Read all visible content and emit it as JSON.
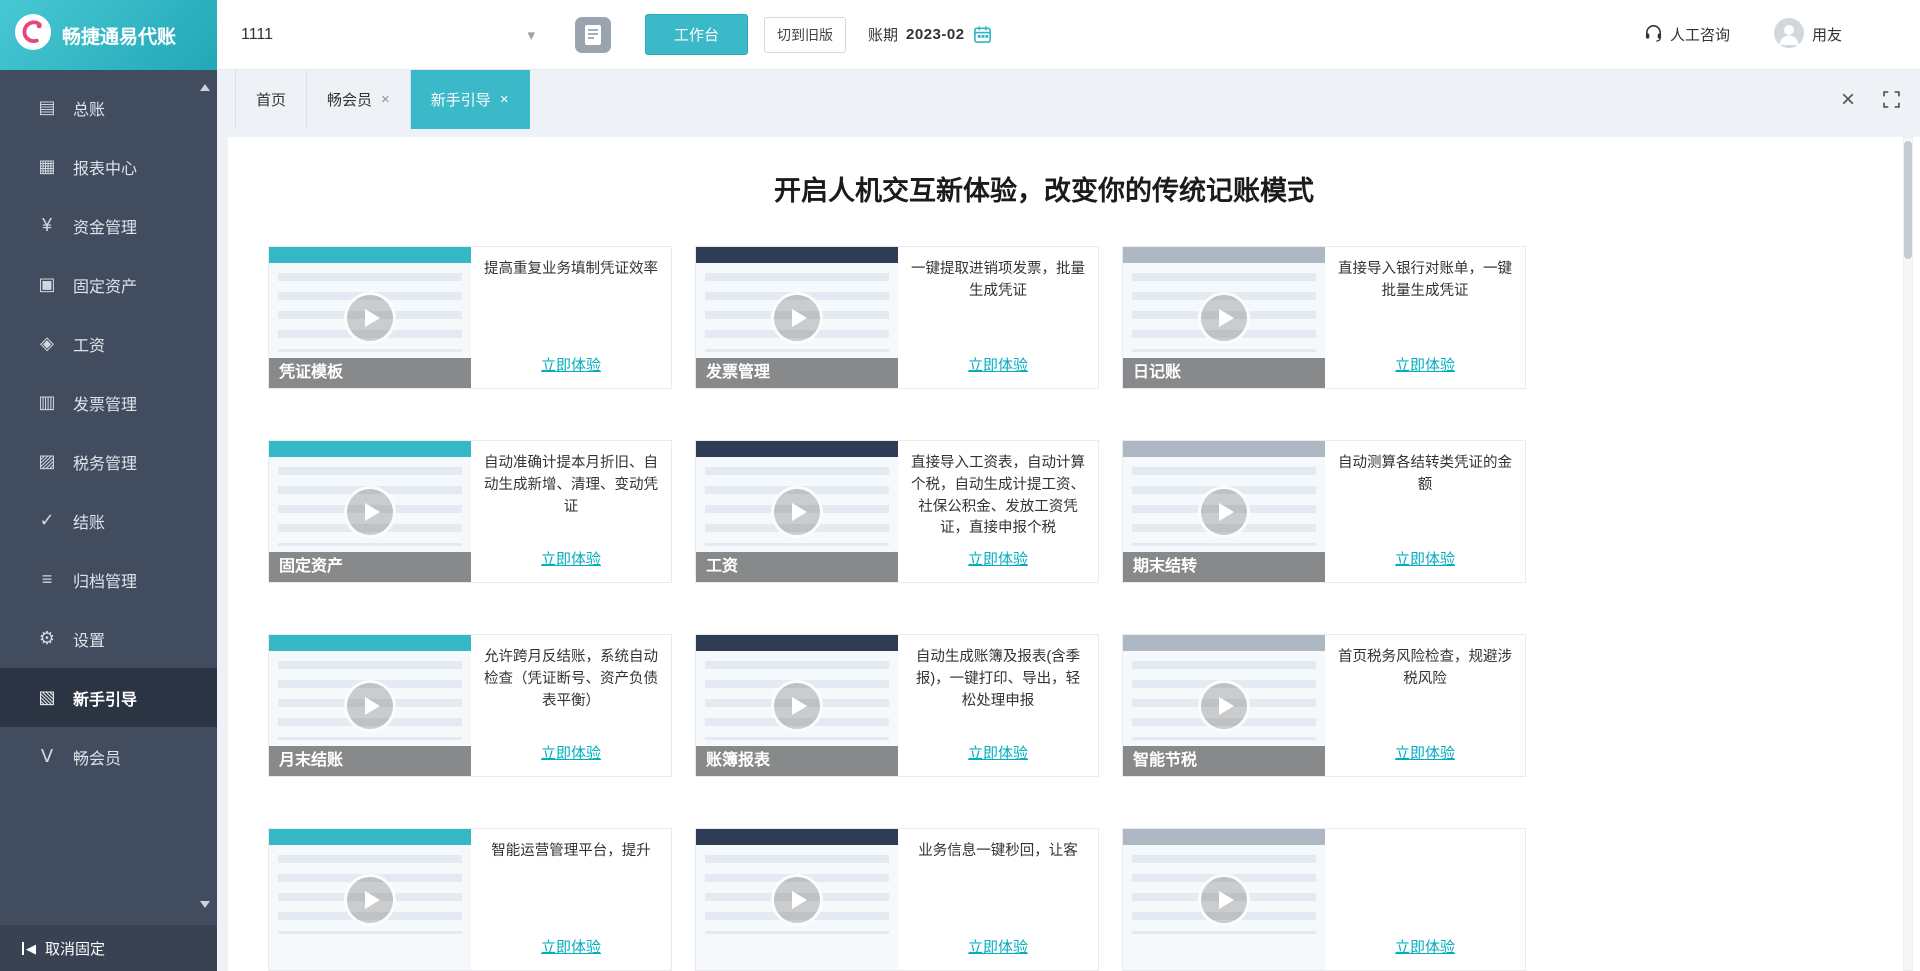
{
  "colors": {
    "accent": "#3cb9c8",
    "sidebar_bg": "#414c5e",
    "sidebar_active_bg": "#2b3442",
    "link": "#00aebe"
  },
  "header": {
    "brand": "畅捷通易代账",
    "account_value": "1111",
    "workbench_label": "工作台",
    "old_version_label": "切到旧版",
    "period_label": "账期",
    "period_value": "2023-02",
    "support_label": "人工咨询",
    "user_label": "用友"
  },
  "tabs": [
    {
      "key": "home",
      "label": "首页",
      "closable": false,
      "active": false
    },
    {
      "key": "member",
      "label": "畅会员",
      "closable": true,
      "active": false
    },
    {
      "key": "beginner-guide",
      "label": "新手引导",
      "closable": true,
      "active": true
    }
  ],
  "sidebar": {
    "items": [
      {
        "key": "general-ledger",
        "label": "总账",
        "icon": "ledger-icon",
        "glyph": "▤"
      },
      {
        "key": "report-center",
        "label": "报表中心",
        "icon": "report-chart-icon",
        "glyph": "▦"
      },
      {
        "key": "fund-management",
        "label": "资金管理",
        "icon": "fund-icon",
        "glyph": "¥"
      },
      {
        "key": "fixed-assets",
        "label": "固定资产",
        "icon": "fixed-asset-icon",
        "glyph": "▣"
      },
      {
        "key": "payroll",
        "label": "工资",
        "icon": "salary-icon",
        "glyph": "◈"
      },
      {
        "key": "invoice-management",
        "label": "发票管理",
        "icon": "invoice-icon",
        "glyph": "▥"
      },
      {
        "key": "tax-management",
        "label": "税务管理",
        "icon": "tax-icon",
        "glyph": "▨"
      },
      {
        "key": "closing",
        "label": "结账",
        "icon": "closing-check-icon",
        "glyph": "✓"
      },
      {
        "key": "archive-management",
        "label": "归档管理",
        "icon": "archive-icon",
        "glyph": "≡"
      },
      {
        "key": "settings",
        "label": "设置",
        "icon": "settings-gear-icon",
        "glyph": "⚙"
      },
      {
        "key": "beginner-guide",
        "label": "新手引导",
        "icon": "guide-icon",
        "glyph": "▧",
        "active": true
      },
      {
        "key": "member",
        "label": "畅会员",
        "icon": "member-icon",
        "glyph": "Ⅴ"
      }
    ],
    "unpin_label": "取消固定"
  },
  "main": {
    "title": "开启人机交互新体验，改变你的传统记账模式",
    "cta_label": "立即体验",
    "cards": [
      {
        "key": "voucher-template",
        "name": "凭证模板",
        "desc": "提高重复业务填制凭证效率"
      },
      {
        "key": "invoice-management",
        "name": "发票管理",
        "desc": "一键提取进销项发票，批量生成凭证"
      },
      {
        "key": "journal",
        "name": "日记账",
        "desc": "直接导入银行对账单，一键批量生成凭证"
      },
      {
        "key": "fixed-assets",
        "name": "固定资产",
        "desc": "自动准确计提本月折旧、自动生成新增、清理、变动凭证"
      },
      {
        "key": "payroll",
        "name": "工资",
        "desc": "直接导入工资表，自动计算个税，自动生成计提工资、社保公积金、发放工资凭证，直接申报个税"
      },
      {
        "key": "period-end-carryover",
        "name": "期末结转",
        "desc": "自动测算各结转类凭证的金额"
      },
      {
        "key": "month-end-closing",
        "name": "月末结账",
        "desc": "允许跨月反结账，系统自动检查（凭证断号、资产负债表平衡）"
      },
      {
        "key": "books-reports",
        "name": "账簿报表",
        "desc": "自动生成账簿及报表(含季报)，一键打印、导出，轻松处理申报"
      },
      {
        "key": "smart-tax-saving",
        "name": "智能节税",
        "desc": "首页税务风险检查，规避涉税风险"
      },
      {
        "key": "operations-platform",
        "name": "",
        "desc": "智能运营管理平台，提升",
        "partial": true
      },
      {
        "key": "instant-reply",
        "name": "",
        "desc": "业务信息一键秒回，让客",
        "partial": true
      },
      {
        "key": "partial-3",
        "name": "",
        "desc": "",
        "partial": true
      }
    ]
  }
}
